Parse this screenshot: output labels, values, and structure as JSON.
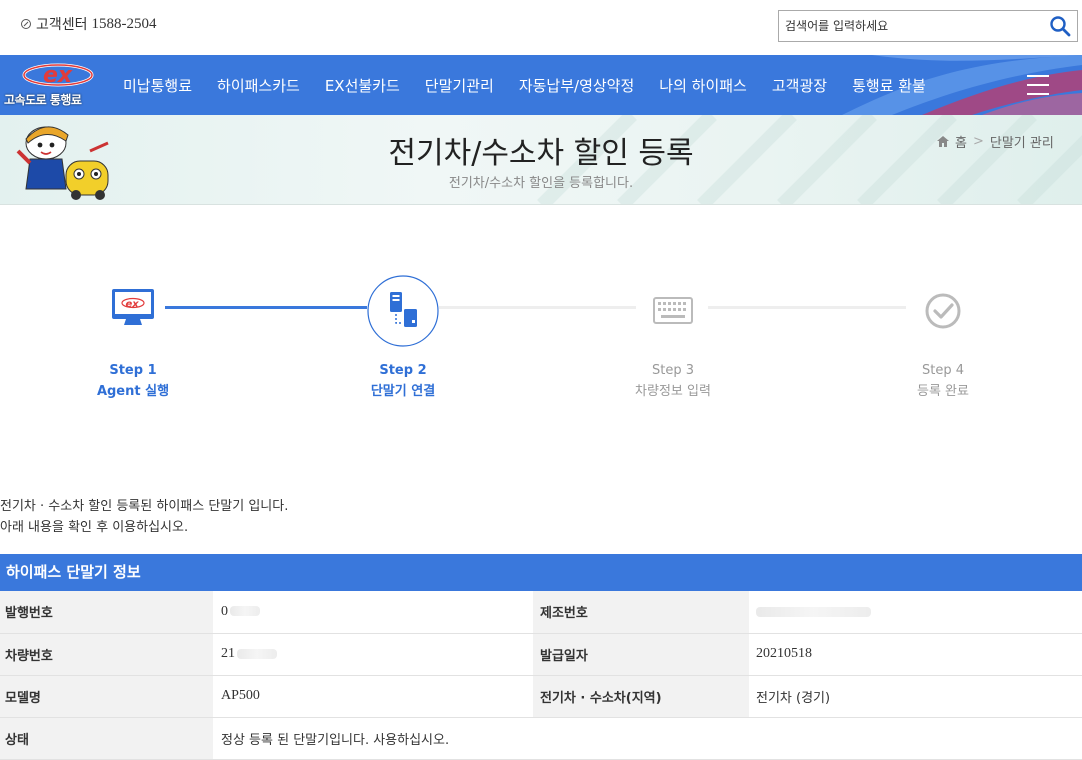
{
  "topbar": {
    "cs_label": "고객센터",
    "cs_number": "1588-2504",
    "search_placeholder": "검색어를 입력하세요"
  },
  "gnb": {
    "logo_text": "고속도로 통행료",
    "logo_mark": "ex",
    "menu": [
      "미납통행료",
      "하이패스카드",
      "EX선불카드",
      "단말기관리",
      "자동납부/영상약정",
      "나의 하이패스",
      "고객광장",
      "통행료 환불"
    ]
  },
  "banner": {
    "title": "전기차/수소차 할인 등록",
    "subtitle": "전기차/수소차 할인을 등록합니다.",
    "breadcrumb_home": "홈",
    "breadcrumb_current": "단말기 관리"
  },
  "steps": [
    {
      "step": "Step 1",
      "label": "Agent 실행",
      "state": "done",
      "icon": "monitor-ex-icon"
    },
    {
      "step": "Step 2",
      "label": "단말기 연결",
      "state": "current",
      "icon": "device-connect-icon"
    },
    {
      "step": "Step 3",
      "label": "차량정보 입력",
      "state": "todo",
      "icon": "keyboard-icon"
    },
    {
      "step": "Step 4",
      "label": "등록 완료",
      "state": "todo",
      "icon": "check-circle-icon"
    }
  ],
  "notice": {
    "line1": "전기차 · 수소차 할인 등록된 하이패스 단말기 입니다.",
    "line2": "아래 내용을 확인 후 이용하십시오."
  },
  "info_table": {
    "title": "하이패스 단말기 정보",
    "rows": [
      {
        "label1": "발행번호",
        "value1": "0",
        "label2": "제조번호",
        "value2": ""
      },
      {
        "label1": "차량번호",
        "value1": "21",
        "label2": "발급일자",
        "value2": "20210518"
      },
      {
        "label1": "모델명",
        "value1": "AP500",
        "label2": "전기차 · 수소차(지역)",
        "value2": "전기차 (경기)"
      },
      {
        "label1": "상태",
        "value1": "정상 등록 된 단말기입니다. 사용하십시오."
      }
    ]
  },
  "colors": {
    "primary": "#3a78dc",
    "step_active": "#2f6fd6",
    "step_inactive": "#999999"
  }
}
